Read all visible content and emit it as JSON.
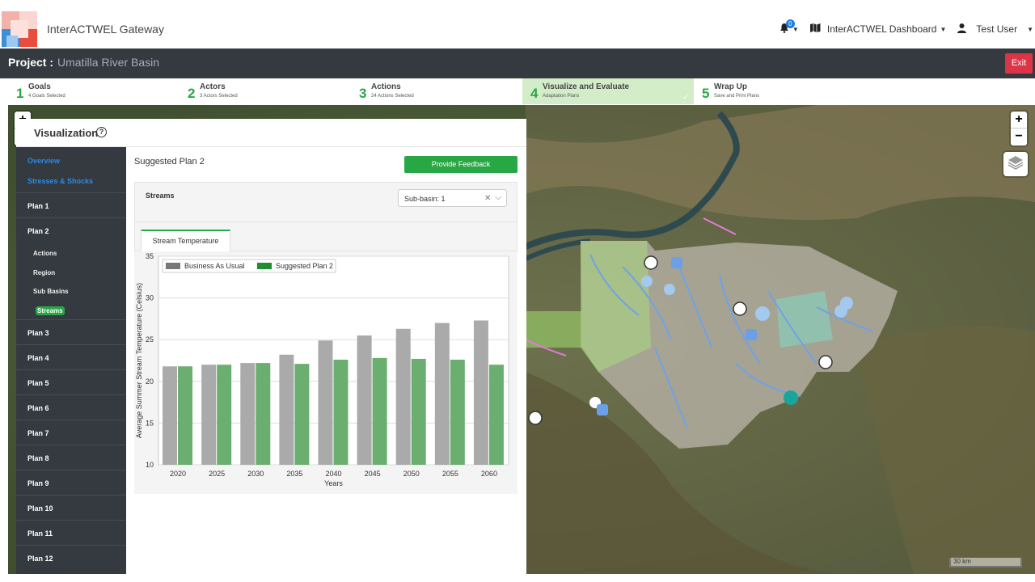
{
  "header": {
    "brand": "InterACTWEL Gateway",
    "notification_count": "0",
    "dashboard_label": "InterACTWEL Dashboard",
    "user_label": "Test User"
  },
  "project": {
    "label": "Project :",
    "name": "Umatilla River Basin",
    "exit_label": "Exit"
  },
  "steps": [
    {
      "num": "1",
      "title": "Goals",
      "sub": "4 Goals Selected"
    },
    {
      "num": "2",
      "title": "Actors",
      "sub": "3 Actors Selected"
    },
    {
      "num": "3",
      "title": "Actions",
      "sub": "24 Actions Selected"
    },
    {
      "num": "4",
      "title": "Visualize and Evaluate",
      "sub": "Adaptation Plans"
    },
    {
      "num": "5",
      "title": "Wrap Up",
      "sub": "Save and Print Plans"
    }
  ],
  "map": {
    "zoom_in": "+",
    "zoom_out": "−",
    "scale_label": "30 km"
  },
  "panel": {
    "title": "Visualization"
  },
  "sidebar": {
    "overview": "Overview",
    "stresses": "Stresses & Shocks",
    "plans": [
      "Plan 1",
      "Plan 2",
      "Plan 3",
      "Plan 4",
      "Plan 5",
      "Plan 6",
      "Plan 7",
      "Plan 8",
      "Plan 9",
      "Plan 10",
      "Plan 11",
      "Plan 12"
    ],
    "plan2_sub": [
      "Actions",
      "Region",
      "Sub Basins",
      "Streams"
    ]
  },
  "content": {
    "plan_title": "Suggested Plan 2",
    "feedback_label": "Provide Feedback",
    "streams_label": "Streams",
    "subbasin_value": "Sub-basin: 1",
    "tab_label": "Stream Temperature"
  },
  "colors": {
    "accent_green": "#28a745",
    "exit_red": "#dc3545",
    "bau_gray": "#aaaaaa",
    "plan_green": "#6aaf70"
  },
  "chart_data": {
    "type": "bar",
    "categories": [
      "2020",
      "2025",
      "2030",
      "2035",
      "2040",
      "2045",
      "2050",
      "2055",
      "2060"
    ],
    "series": [
      {
        "name": "Business As Usual",
        "values": [
          21.8,
          22.0,
          22.2,
          23.2,
          24.9,
          25.5,
          26.3,
          27.0,
          27.3
        ]
      },
      {
        "name": "Suggested Plan 2",
        "values": [
          21.8,
          22.0,
          22.2,
          22.1,
          22.6,
          22.8,
          22.7,
          22.6,
          22.0
        ]
      }
    ],
    "xlabel": "Years",
    "ylabel": "Average Summer Stream Temperature (Celsius)",
    "ylim": [
      10,
      35
    ],
    "yticks": [
      "10",
      "15",
      "20",
      "25",
      "30",
      "35"
    ],
    "grid": true,
    "legend": "top-left"
  }
}
